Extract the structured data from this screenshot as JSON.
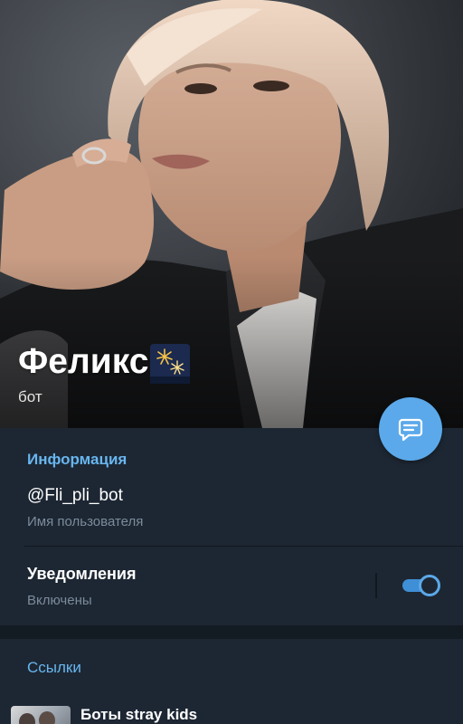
{
  "profile": {
    "name": "Феликс",
    "name_icon": "firework-sparkler-icon",
    "status": "бот"
  },
  "info_section": {
    "title": "Информация",
    "username_value": "@Fli_pli_bot",
    "username_caption": "Имя пользователя",
    "notifications_label": "Уведомления",
    "notifications_state": "Включены",
    "notifications_enabled": true
  },
  "links_section": {
    "title": "Ссылки",
    "items": [
      {
        "title": "Боты stray kids"
      }
    ]
  },
  "colors": {
    "accent": "#5ba9ea",
    "section_title": "#68b6ef",
    "background": "#1d2733",
    "caption": "#7c8b9a"
  },
  "icons": {
    "fab": "message-icon"
  }
}
